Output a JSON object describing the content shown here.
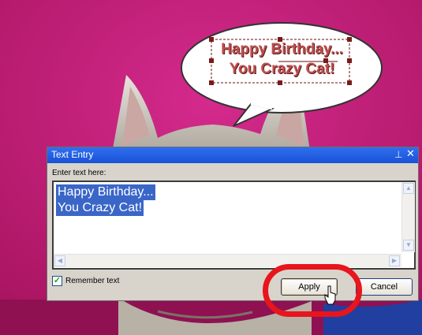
{
  "bubble": {
    "line1": "Happy Birthday...",
    "line2": "You Crazy Cat!"
  },
  "dialog": {
    "title": "Text Entry",
    "pin_icon": "pin-icon",
    "close_icon": "close-icon",
    "prompt": "Enter text here:",
    "text_lines": [
      "Happy Birthday...",
      "You Crazy Cat!"
    ],
    "remember_label": "Remember text",
    "remember_checked": true,
    "apply_label": "Apply",
    "cancel_label": "Cancel"
  },
  "colors": {
    "background": "#c21b7b",
    "titlebar": "#2562e4",
    "selection": "#3a66c8",
    "bubble_text": "#c04e4e",
    "highlight_ring": "#e8151c"
  }
}
